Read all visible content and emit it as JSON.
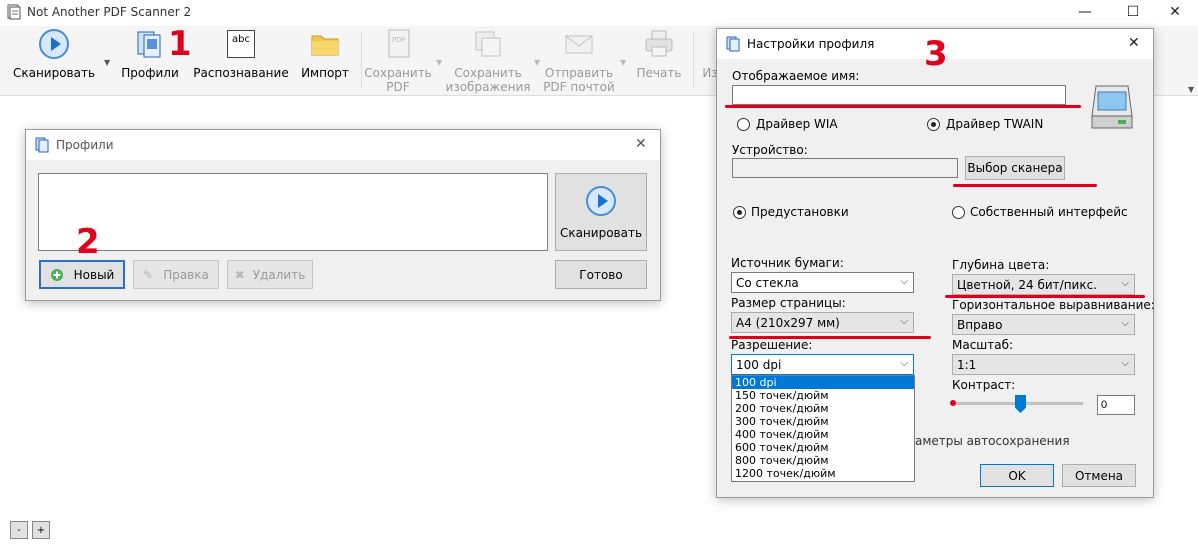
{
  "app": {
    "title": "Not Another PDF Scanner 2",
    "minimize": "—",
    "maximize": "☐",
    "close": "✕"
  },
  "toolbar": {
    "scan": "Сканировать",
    "profiles": "Профили",
    "ocr": "Распознавание",
    "import": "Импорт",
    "save_pdf_1": "Сохранить",
    "save_pdf_2": "PDF",
    "save_images_1": "Сохранить",
    "save_images_2": "изображения",
    "email_pdf_1": "Отправить",
    "email_pdf_2": "PDF почтой",
    "print": "Печать",
    "cut_label": "Из",
    "ocr_icon_text": "abc"
  },
  "annotations": {
    "n1": "1",
    "n2": "2",
    "n3": "3"
  },
  "profiles_dialog": {
    "title": "Профили",
    "close": "✕",
    "scan": "Сканировать",
    "new": "Новый",
    "edit": "Правка",
    "delete": "Удалить",
    "done": "Готово"
  },
  "settings_dialog": {
    "title": "Настройки профиля",
    "close": "✕",
    "display_name_label": "Отображаемое имя:",
    "display_name_value": "",
    "driver_wia": "Драйвер WIA",
    "driver_twain": "Драйвер TWAIN",
    "device_label": "Устройство:",
    "device_value": "",
    "choose_scanner": "Выбор сканера",
    "presets": "Предустановки",
    "native_ui": "Собственный интерфейс",
    "paper_source_label": "Источник бумаги:",
    "paper_source_value": "Со стекла",
    "page_size_label": "Размер страницы:",
    "page_size_value": "A4 (210x297 мм)",
    "resolution_label": "Разрешение:",
    "resolution_value": "100 dpi",
    "resolution_options": [
      "100 dpi",
      "150 точек/дюйм",
      "200 точек/дюйм",
      "300 точек/дюйм",
      "400 точек/дюйм",
      "600 точек/дюйм",
      "800 точек/дюйм",
      "1200 точек/дюйм"
    ],
    "color_depth_label": "Глубина цвета:",
    "color_depth_value": "Цветной, 24 бит/пикс.",
    "h_align_label": "Горизонтальное выравнивание:",
    "h_align_value": "Вправо",
    "scale_label": "Масштаб:",
    "scale_value": "1:1",
    "contrast_label": "Контраст:",
    "contrast_value": "0",
    "autosave_partial": "аметры автосохранения",
    "ok": "OK",
    "cancel": "Отмена"
  },
  "status": {
    "zoom_out": "-",
    "zoom_in": "+"
  },
  "colors": {
    "accent": "#0078d7",
    "annotation_red": "#e0001b"
  }
}
